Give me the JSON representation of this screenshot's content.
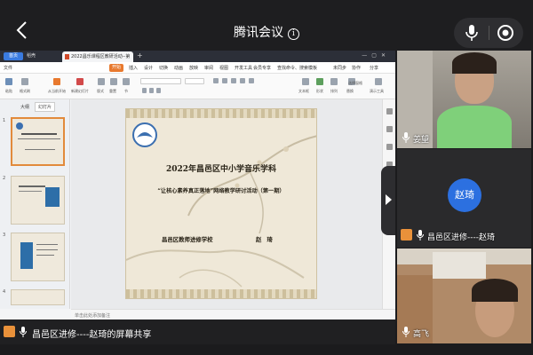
{
  "meeting": {
    "title": "腾讯会议",
    "info_glyph": "i"
  },
  "app_tabs": {
    "home": "首页",
    "doc1": "稻壳",
    "doc2": "2022昌乐课程区教研活动--第"
  },
  "menus": [
    "文件",
    "开始",
    "插入",
    "设计",
    "切换",
    "动画",
    "放映",
    "审阅",
    "视图",
    "开发工具",
    "会员专享",
    "查找命令、搜索模板",
    "未同步",
    "协作",
    "分享"
  ],
  "menu_active": "开始",
  "ribbon_labels": [
    "粘贴",
    "格式刷",
    "从当前开始",
    "新建幻灯片",
    "版式",
    "重置",
    "节",
    "文本框",
    "形状",
    "排列",
    "替换",
    "选择窗格",
    "演示工具"
  ],
  "thumb_pane": {
    "tab_outline": "大纲",
    "tab_slides": "幻灯片",
    "numbers": [
      "1",
      "2",
      "3",
      "4"
    ],
    "add_glyph": "+"
  },
  "status_bar": {
    "notes": "单击此处添加备注"
  },
  "slide": {
    "line1": "2022年昌邑区中小学音乐学科",
    "line2": "“让核心素养真正落地”网络教学研讨活动（第一期）",
    "line3": "昌邑区教师进修学校",
    "line4": "赵琦"
  },
  "participants": [
    {
      "name": "姜望"
    },
    {
      "name": "昌邑区进修----赵琦",
      "avatar_text": "赵琦"
    },
    {
      "name": "高飞"
    }
  ],
  "share_caption": "昌邑区进修----赵琦的屏幕共享",
  "colors": {
    "accent_blue": "#2c70e0",
    "mic_green": "#34c759",
    "wps_orange": "#e8792e"
  }
}
